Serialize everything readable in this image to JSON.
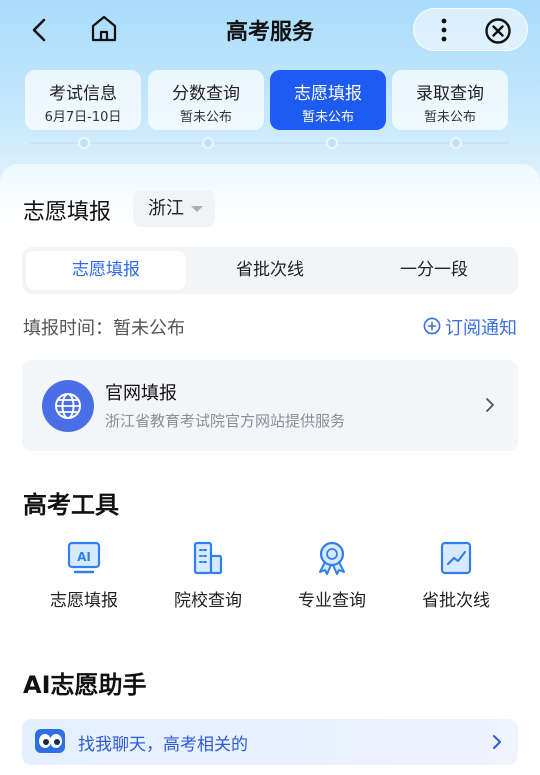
{
  "header": {
    "title": "高考服务",
    "icons": {
      "back": "back-arrow-icon",
      "home": "home-icon",
      "more": "more-vertical-icon",
      "close": "close-circle-icon"
    }
  },
  "stage_tabs": [
    {
      "label": "考试信息",
      "sub": "6月7日-10日",
      "active": false
    },
    {
      "label": "分数查询",
      "sub": "暂未公布",
      "active": false
    },
    {
      "label": "志愿填报",
      "sub": "暂未公布",
      "active": true
    },
    {
      "label": "录取查询",
      "sub": "暂未公布",
      "active": false
    }
  ],
  "section": {
    "title": "志愿填报",
    "province": "浙江"
  },
  "segments": [
    {
      "label": "志愿填报",
      "active": true
    },
    {
      "label": "省批次线",
      "active": false
    },
    {
      "label": "一分一段",
      "active": false
    }
  ],
  "fill_time": "填报时间：暂未公布",
  "subscribe_label": "订阅通知",
  "official_card": {
    "title": "官网填报",
    "subtitle": "浙江省教育考试院官方网站提供服务"
  },
  "tools": {
    "title": "高考工具",
    "items": [
      {
        "label": "志愿填报",
        "icon": "ai-screen-icon"
      },
      {
        "label": "院校查询",
        "icon": "building-icon"
      },
      {
        "label": "专业查询",
        "icon": "award-badge-icon"
      },
      {
        "label": "省批次线",
        "icon": "trend-chart-icon"
      }
    ]
  },
  "ai_assistant": {
    "title": "AI志愿助手",
    "prompt": "找我聊天，高考相关的"
  },
  "colors": {
    "accent": "#1e5bf0",
    "link": "#3a70e6",
    "icon_blue": "#2f7ff0"
  }
}
